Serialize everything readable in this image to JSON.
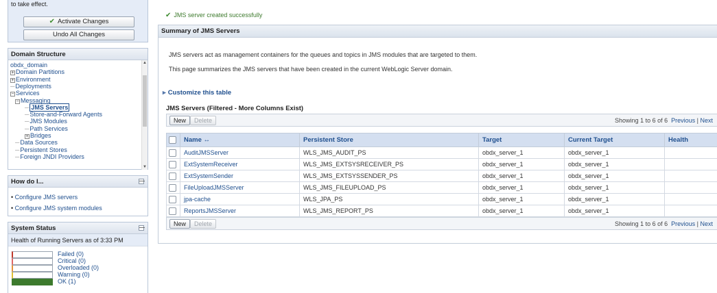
{
  "change_center": {
    "message": "to take effect.",
    "activate_label": "Activate Changes",
    "undo_label": "Undo All Changes"
  },
  "domain_structure": {
    "title": "Domain Structure",
    "items": [
      {
        "label": "obdx_domain",
        "prefix": "",
        "indent": 0
      },
      {
        "label": "Domain Partitions",
        "prefix": "+",
        "indent": 0
      },
      {
        "label": "Environment",
        "prefix": "+",
        "indent": 0
      },
      {
        "label": "Deployments",
        "prefix": "-",
        "indent": 0
      },
      {
        "label": "Services",
        "prefix": "−",
        "indent": 0
      },
      {
        "label": "Messaging",
        "prefix": "−",
        "indent": 1
      },
      {
        "label": "JMS Servers",
        "prefix": "-",
        "indent": 2
      },
      {
        "label": "Store-and-Forward Agents",
        "prefix": "-",
        "indent": 2
      },
      {
        "label": "JMS Modules",
        "prefix": "-",
        "indent": 2
      },
      {
        "label": "Path Services",
        "prefix": "-",
        "indent": 2
      },
      {
        "label": "Bridges",
        "prefix": "+",
        "indent": 2
      },
      {
        "label": "Data Sources",
        "prefix": "-",
        "indent": 1
      },
      {
        "label": "Persistent Stores",
        "prefix": "-",
        "indent": 1
      },
      {
        "label": "Foreign JNDI Providers",
        "prefix": "-",
        "indent": 1
      }
    ]
  },
  "how_do_i": {
    "title": "How do I...",
    "links": [
      "Configure JMS servers",
      "Configure JMS system modules"
    ]
  },
  "system_status": {
    "title": "System Status",
    "subtitle": "Health of Running Servers as of  3:33 PM",
    "rows": [
      {
        "label": "Failed (0)",
        "color": "#c0392b",
        "fill": 0
      },
      {
        "label": "Critical (0)",
        "color": "#e06666",
        "fill": 0
      },
      {
        "label": "Overloaded (0)",
        "color": "#e69138",
        "fill": 0
      },
      {
        "label": "Warning (0)",
        "color": "#e0c030",
        "fill": 0
      },
      {
        "label": "OK (1)",
        "color": "#3d7a2d",
        "fill": 1
      }
    ]
  },
  "main": {
    "success_message": "JMS server created successfully",
    "summary_title": "Summary of JMS Servers",
    "desc1": "JMS servers act as management containers for the queues and topics in JMS modules that are targeted to them.",
    "desc2": "This page summarizes the JMS servers that have been created in the current WebLogic Server domain.",
    "customize_label": "Customize this table",
    "table_caption": "JMS Servers (Filtered - More Columns Exist)",
    "new_label": "New",
    "delete_label": "Delete",
    "paging_text": "Showing 1 to 6 of 6",
    "previous_label": "Previous",
    "next_label": "Next",
    "columns": [
      "Name ↔",
      "Persistent Store",
      "Target",
      "Current Target",
      "Health"
    ],
    "rows": [
      {
        "name": "AuditJMSServer",
        "store": "WLS_JMS_AUDIT_PS",
        "target": "obdx_server_1",
        "current": "obdx_server_1",
        "health": ""
      },
      {
        "name": "ExtSystemReceiver",
        "store": "WLS_JMS_EXTSYSRECEIVER_PS",
        "target": "obdx_server_1",
        "current": "obdx_server_1",
        "health": ""
      },
      {
        "name": "ExtSystemSender",
        "store": "WLS_JMS_EXTSYSSENDER_PS",
        "target": "obdx_server_1",
        "current": "obdx_server_1",
        "health": ""
      },
      {
        "name": "FileUploadJMSServer",
        "store": "WLS_JMS_FILEUPLOAD_PS",
        "target": "obdx_server_1",
        "current": "obdx_server_1",
        "health": ""
      },
      {
        "name": "jpa-cache",
        "store": "WLS_JPA_PS",
        "target": "obdx_server_1",
        "current": "obdx_server_1",
        "health": ""
      },
      {
        "name": "ReportsJMSServer",
        "store": "WLS_JMS_REPORT_PS",
        "target": "obdx_server_1",
        "current": "obdx_server_1",
        "health": ""
      }
    ]
  }
}
